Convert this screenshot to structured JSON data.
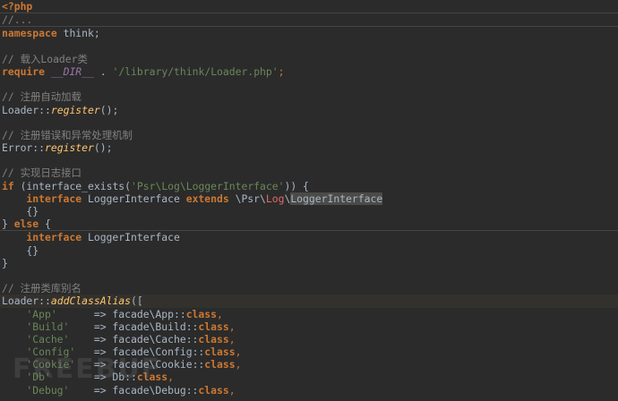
{
  "colors": {
    "background": "#2b2b2b",
    "keyword": "#cc7832",
    "string": "#6a8759",
    "comment": "#808080",
    "function": "#ffc66d",
    "default": "#a9b7c6"
  },
  "watermark": "FREEBUF",
  "lines": [
    {
      "cls": "sep",
      "indent": 0,
      "tokens": [
        {
          "t": "<?php",
          "c": "ptag"
        }
      ]
    },
    {
      "cls": "sep",
      "indent": 0,
      "tokens": [
        {
          "t": "//...",
          "c": "cmt"
        }
      ]
    },
    {
      "cls": "",
      "indent": 0,
      "tokens": [
        {
          "t": "namespace",
          "c": "kw"
        },
        {
          "t": " think;",
          "c": ""
        }
      ]
    },
    {
      "cls": "",
      "indent": 0,
      "tokens": []
    },
    {
      "cls": "",
      "indent": 0,
      "tokens": [
        {
          "t": "// 载入Loader类",
          "c": "cmt"
        }
      ]
    },
    {
      "cls": "",
      "indent": 0,
      "tokens": [
        {
          "t": "require",
          "c": "kw"
        },
        {
          "t": " ",
          "c": ""
        },
        {
          "t": "__DIR__",
          "c": "mc"
        },
        {
          "t": " . ",
          "c": ""
        },
        {
          "t": "'/library/think/Loader.php'",
          "c": "str"
        },
        {
          "t": ";",
          "c": "kw2"
        }
      ]
    },
    {
      "cls": "",
      "indent": 0,
      "tokens": []
    },
    {
      "cls": "",
      "indent": 0,
      "tokens": [
        {
          "t": "// 注册自动加载",
          "c": "cmt"
        }
      ]
    },
    {
      "cls": "",
      "indent": 0,
      "tokens": [
        {
          "t": "Loader::",
          "c": ""
        },
        {
          "t": "register",
          "c": "fn"
        },
        {
          "t": "();",
          "c": ""
        }
      ]
    },
    {
      "cls": "",
      "indent": 0,
      "tokens": []
    },
    {
      "cls": "",
      "indent": 0,
      "tokens": [
        {
          "t": "// 注册错误和异常处理机制",
          "c": "cmt"
        }
      ]
    },
    {
      "cls": "",
      "indent": 0,
      "tokens": [
        {
          "t": "Error::",
          "c": ""
        },
        {
          "t": "register",
          "c": "fn"
        },
        {
          "t": "();",
          "c": ""
        }
      ]
    },
    {
      "cls": "",
      "indent": 0,
      "tokens": []
    },
    {
      "cls": "",
      "indent": 0,
      "tokens": [
        {
          "t": "// 实现日志接口",
          "c": "cmt"
        }
      ]
    },
    {
      "cls": "",
      "indent": 0,
      "tokens": [
        {
          "t": "if",
          "c": "kw"
        },
        {
          "t": " (interface_exists(",
          "c": ""
        },
        {
          "t": "'Psr\\Log\\LoggerInterface'",
          "c": "str"
        },
        {
          "t": ")) {",
          "c": ""
        }
      ]
    },
    {
      "cls": "",
      "indent": 2,
      "tokens": [
        {
          "t": "interface",
          "c": "kw"
        },
        {
          "t": " LoggerInterface ",
          "c": ""
        },
        {
          "t": "extends",
          "c": "kw"
        },
        {
          "t": " \\Psr\\",
          "c": ""
        },
        {
          "t": "Log",
          "c": "hlt"
        },
        {
          "t": "\\",
          "c": ""
        },
        {
          "t": "LoggerInterface",
          "c": "sel"
        }
      ]
    },
    {
      "cls": "",
      "indent": 2,
      "tokens": [
        {
          "t": "{}",
          "c": ""
        }
      ]
    },
    {
      "cls": "sep",
      "indent": 0,
      "tokens": [
        {
          "t": "} ",
          "c": ""
        },
        {
          "t": "else",
          "c": "kw"
        },
        {
          "t": " {",
          "c": ""
        }
      ]
    },
    {
      "cls": "",
      "indent": 2,
      "tokens": [
        {
          "t": "interface",
          "c": "kw"
        },
        {
          "t": " LoggerInterface",
          "c": ""
        }
      ]
    },
    {
      "cls": "",
      "indent": 2,
      "tokens": [
        {
          "t": "{}",
          "c": ""
        }
      ]
    },
    {
      "cls": "",
      "indent": 0,
      "tokens": [
        {
          "t": "}",
          "c": ""
        }
      ]
    },
    {
      "cls": "",
      "indent": 0,
      "tokens": []
    },
    {
      "cls": "",
      "indent": 0,
      "tokens": [
        {
          "t": "// 注册类库别名",
          "c": "cmt"
        }
      ]
    },
    {
      "cls": "hl",
      "indent": 0,
      "tokens": [
        {
          "t": "Loader::",
          "c": ""
        },
        {
          "t": "addClassAlias",
          "c": "fn"
        },
        {
          "t": "([",
          "c": ""
        }
      ]
    },
    {
      "cls": "",
      "indent": 2,
      "tokens": [
        {
          "t": "'App'",
          "c": "str"
        },
        {
          "t": "      => facade\\App::",
          "c": ""
        },
        {
          "t": "class",
          "c": "kw"
        },
        {
          "t": ",",
          "c": "kw2"
        }
      ]
    },
    {
      "cls": "",
      "indent": 2,
      "tokens": [
        {
          "t": "'Build'",
          "c": "str"
        },
        {
          "t": "    => facade\\Build::",
          "c": ""
        },
        {
          "t": "class",
          "c": "kw"
        },
        {
          "t": ",",
          "c": "kw2"
        }
      ]
    },
    {
      "cls": "",
      "indent": 2,
      "tokens": [
        {
          "t": "'Cache'",
          "c": "str"
        },
        {
          "t": "    => facade\\Cache::",
          "c": ""
        },
        {
          "t": "class",
          "c": "kw"
        },
        {
          "t": ",",
          "c": "kw2"
        }
      ]
    },
    {
      "cls": "",
      "indent": 2,
      "tokens": [
        {
          "t": "'Config'",
          "c": "str"
        },
        {
          "t": "   => facade\\Config::",
          "c": ""
        },
        {
          "t": "class",
          "c": "kw"
        },
        {
          "t": ",",
          "c": "kw2"
        }
      ]
    },
    {
      "cls": "",
      "indent": 2,
      "tokens": [
        {
          "t": "'Cookie'",
          "c": "str"
        },
        {
          "t": "   => facade\\Cookie::",
          "c": ""
        },
        {
          "t": "class",
          "c": "kw"
        },
        {
          "t": ",",
          "c": "kw2"
        }
      ]
    },
    {
      "cls": "",
      "indent": 2,
      "tokens": [
        {
          "t": "'Db'",
          "c": "str"
        },
        {
          "t": "       => Db::",
          "c": ""
        },
        {
          "t": "class",
          "c": "kw"
        },
        {
          "t": ",",
          "c": "kw2"
        }
      ]
    },
    {
      "cls": "",
      "indent": 2,
      "tokens": [
        {
          "t": "'Debug'",
          "c": "str"
        },
        {
          "t": "    => facade\\Debug::",
          "c": ""
        },
        {
          "t": "class",
          "c": "kw"
        },
        {
          "t": ",",
          "c": "kw2"
        }
      ]
    }
  ]
}
